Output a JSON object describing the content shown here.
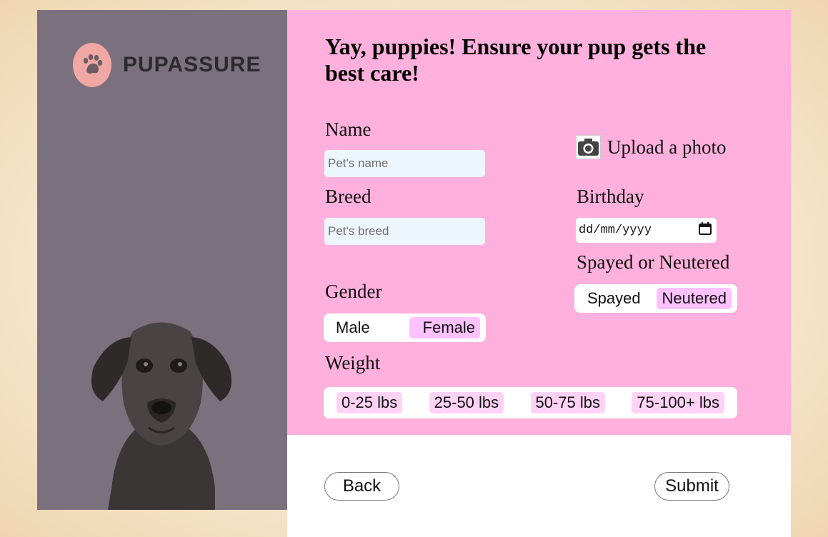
{
  "brand": {
    "name": "PUPASSURE",
    "logo_icon": "paw-icon",
    "logo_color": "#f1a7a3"
  },
  "form": {
    "headline": "Yay, puppies! Ensure your pup gets the best care!",
    "name": {
      "label": "Name",
      "placeholder": "Pet's name"
    },
    "breed": {
      "label": "Breed",
      "placeholder": "Pet's breed"
    },
    "upload": {
      "label": "Upload a photo",
      "icon": "camera-icon"
    },
    "birthday": {
      "label": "Birthday",
      "placeholder": "dd/mm/yyyy",
      "icon": "calendar-icon"
    },
    "spay": {
      "label": "Spayed or Neutered",
      "options": [
        "Spayed",
        "Neutered"
      ],
      "selected": "Neutered"
    },
    "gender": {
      "label": "Gender",
      "options": [
        "Male",
        "Female"
      ],
      "selected": "Female"
    },
    "weight": {
      "label": "Weight",
      "options": [
        "0-25 lbs",
        "25-50 lbs",
        "50-75 lbs",
        "75-100+ lbs"
      ]
    }
  },
  "actions": {
    "back": "Back",
    "submit": "Submit"
  },
  "colors": {
    "left_panel": "#7b707d",
    "form_bg": "#ffb0dc",
    "selected_option": "#ffc1ff",
    "input_bg": "#edf6fd"
  }
}
